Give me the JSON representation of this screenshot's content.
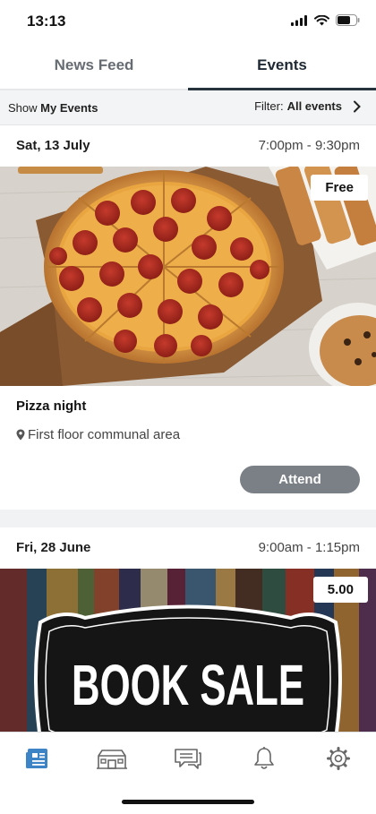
{
  "status_bar": {
    "time": "13:13"
  },
  "tabs": [
    {
      "label": "News Feed",
      "active": false
    },
    {
      "label": "Events",
      "active": true
    }
  ],
  "filter_bar": {
    "show_prefix": "Show",
    "show_value": "My Events",
    "filter_prefix": "Filter:",
    "filter_value": "All events"
  },
  "events": [
    {
      "date": "Sat, 13 July",
      "time": "7:00pm - 9:30pm",
      "price": "Free",
      "title": "Pizza night",
      "location": "First floor communal area",
      "attend_label": "Attend"
    },
    {
      "date": "Fri, 28 June",
      "time": "9:00am - 1:15pm",
      "price": "5.00",
      "image_text": "BOOK SALE"
    }
  ],
  "bottom_nav": {
    "items": [
      {
        "icon": "news-feed-icon",
        "active": true
      },
      {
        "icon": "building-icon",
        "active": false
      },
      {
        "icon": "messages-icon",
        "active": false
      },
      {
        "icon": "bell-icon",
        "active": false
      },
      {
        "icon": "gear-icon",
        "active": false
      }
    ]
  },
  "colors": {
    "accent": "#3d84c6",
    "attend_button": "#7b8087",
    "tab_underline": "#26323c"
  }
}
